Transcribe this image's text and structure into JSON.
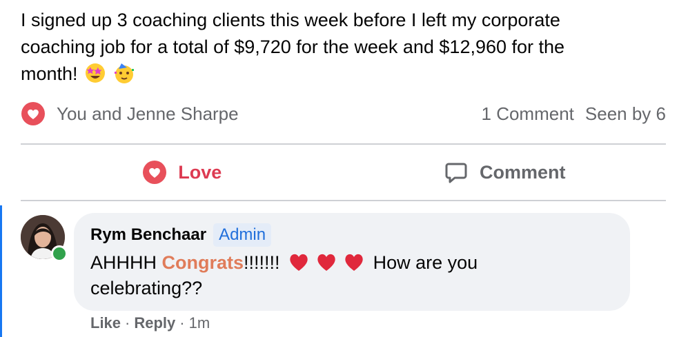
{
  "post": {
    "line1": "I signed up 3 coaching clients this week before I left my corporate",
    "line2": "coaching job for a total of $9,720 for the week and $12,960 for the",
    "line3": "month!",
    "emojis": [
      "star-struck-face",
      "partying-face"
    ]
  },
  "reactions": {
    "summary": "You and Jenne Sharpe",
    "comments": "1 Comment",
    "seen": "Seen by 6"
  },
  "actions": {
    "love": "Love",
    "comment": "Comment"
  },
  "comment": {
    "author": "Rym Benchaar",
    "role": "Admin",
    "text_before": "AHHHH",
    "highlight": "Congrats",
    "exclamations": "!!!!!!!",
    "text_after": "How are you",
    "line2": "celebrating??",
    "like": "Like",
    "sep1": "·",
    "reply": "Reply",
    "sep2": "·",
    "time": "1m"
  },
  "colors": {
    "love": "#dd3b52",
    "admin_badge": "#216fdb",
    "online": "#31a24c",
    "highlight": "#e07c5a"
  }
}
